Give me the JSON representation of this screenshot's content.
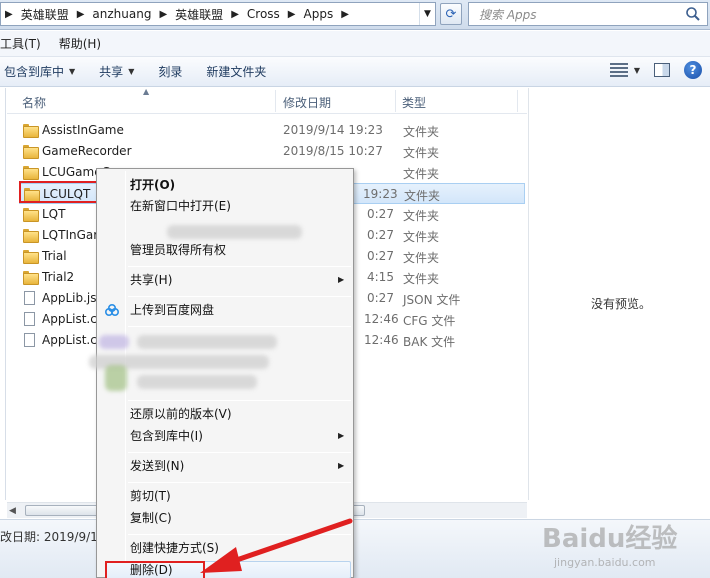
{
  "address_bar": {
    "breadcrumbs": [
      "英雄联盟",
      "anzhuang",
      "英雄联盟",
      "Cross",
      "Apps"
    ],
    "search_placeholder": "搜索 Apps"
  },
  "menu_bar": {
    "items": [
      "工具(T)",
      "帮助(H)"
    ]
  },
  "toolbar": {
    "buttons": [
      "包含到库中",
      "共享",
      "刻录",
      "新建文件夹"
    ]
  },
  "columns": {
    "name": "名称",
    "date": "修改日期",
    "type": "类型"
  },
  "files": [
    {
      "name": "AssistInGame",
      "date": "2019/9/14 19:23",
      "type": "文件夹",
      "icon": "folder-icon"
    },
    {
      "name": "GameRecorder",
      "date": "2019/8/15 10:27",
      "type": "文件夹",
      "icon": "folder-icon"
    },
    {
      "name": "LCUGameC",
      "date": "",
      "type": "文件夹",
      "icon": "folder-icon"
    },
    {
      "name": "LCULQT",
      "date": "19:23",
      "type": "文件夹",
      "icon": "folder-icon",
      "selected": true
    },
    {
      "name": "LQT",
      "date": "0:27",
      "type": "文件夹",
      "icon": "folder-icon"
    },
    {
      "name": "LQTInGar",
      "date": "0:27",
      "type": "文件夹",
      "icon": "folder-icon"
    },
    {
      "name": "Trial",
      "date": "0:27",
      "type": "文件夹",
      "icon": "folder-icon"
    },
    {
      "name": "Trial2",
      "date": "4:15",
      "type": "文件夹",
      "icon": "folder-icon"
    },
    {
      "name": "AppLib.js",
      "date": "0:27",
      "type": "JSON 文件",
      "icon": "file-icon"
    },
    {
      "name": "AppList.c",
      "date": "12:46",
      "type": "CFG 文件",
      "icon": "file-icon"
    },
    {
      "name": "AppList.c",
      "date": "12:46",
      "type": "BAK 文件",
      "icon": "file-icon"
    }
  ],
  "preview": {
    "text": "没有预览。"
  },
  "details": {
    "text": "改日期: 2019/9/14"
  },
  "context_menu": {
    "open": "打开(O)",
    "open_new_window": "在新窗口中打开(E)",
    "take_ownership": "管理员取得所有权",
    "share": "共享(H)",
    "upload_baidu": "上传到百度网盘",
    "restore": "还原以前的版本(V)",
    "include_library": "包含到库中(I)",
    "send_to": "发送到(N)",
    "cut": "剪切(T)",
    "copy": "复制(C)",
    "create_shortcut": "创建快捷方式(S)",
    "delete": "删除(D)"
  },
  "watermark": {
    "logo": "Baidu经验",
    "sub": "jingyan.baidu.com"
  },
  "colors": {
    "annotation_red": "#e02020",
    "selection_blue": "#d3e6fa"
  }
}
